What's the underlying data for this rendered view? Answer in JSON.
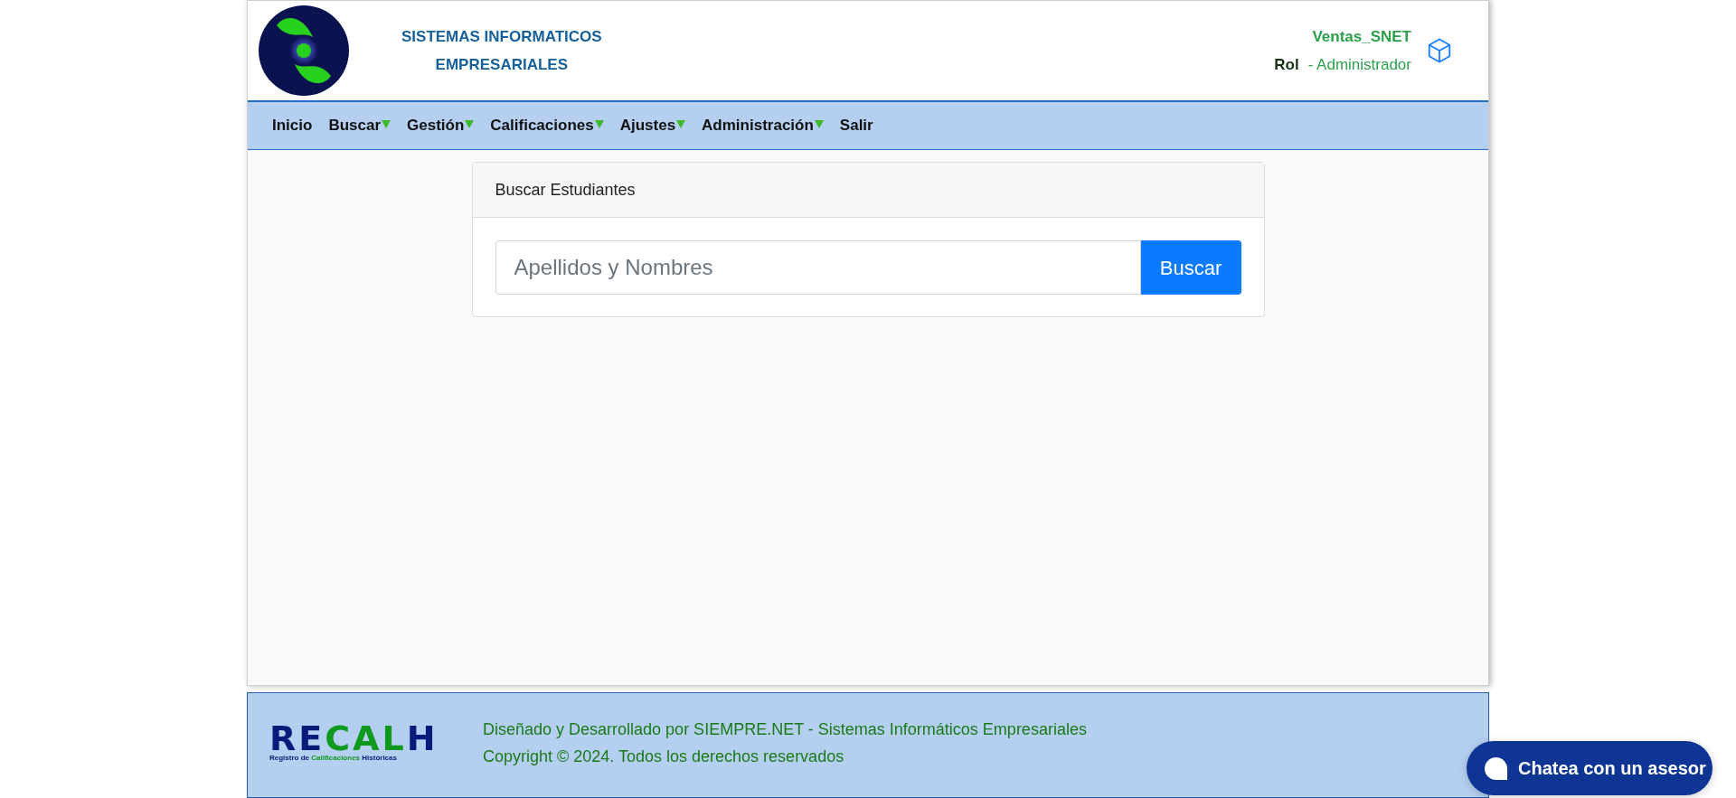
{
  "header": {
    "title_lines": [
      "SISTEMAS INFORMATICOS",
      "EMPRESARIALES"
    ],
    "user": "Ventas_SNET",
    "role_label": "Rol",
    "role_value": "- Administrador"
  },
  "nav": [
    {
      "label": "Inicio",
      "kind": "link"
    },
    {
      "label": "Buscar",
      "kind": "dropdown"
    },
    {
      "label": "Gestión",
      "kind": "dropdown"
    },
    {
      "label": "Calificaciones",
      "kind": "dropdown"
    },
    {
      "label": "Ajustes",
      "kind": "dropdown"
    },
    {
      "label": "Administración",
      "kind": "dropdown"
    },
    {
      "label": "Salir",
      "kind": "link"
    }
  ],
  "search_card": {
    "title": "Buscar Estudiantes",
    "placeholder": "Apellidos y Nombres",
    "button": "Buscar"
  },
  "footer": {
    "logo_parts": [
      {
        "text": "RE",
        "color": "#0a1a7a"
      },
      {
        "text": "CAL",
        "color": "#0f9a1f"
      },
      {
        "text": "H",
        "color": "#0a1a7a"
      }
    ],
    "logo_subtitle_parts": [
      {
        "text": "Registro de ",
        "color": "#0a1a7a"
      },
      {
        "text": "Calificaciones",
        "color": "#0f9a1f"
      },
      {
        "text": " Históricas",
        "color": "#0a1a7a"
      }
    ],
    "lines": [
      "Diseñado y Desarrollado por SIEMPRE.NET - Sistemas Informáticos Empresariales",
      "Copyright © 2024. Todos los derechos reservados"
    ]
  },
  "chat_button": "Chatea con un asesor"
}
